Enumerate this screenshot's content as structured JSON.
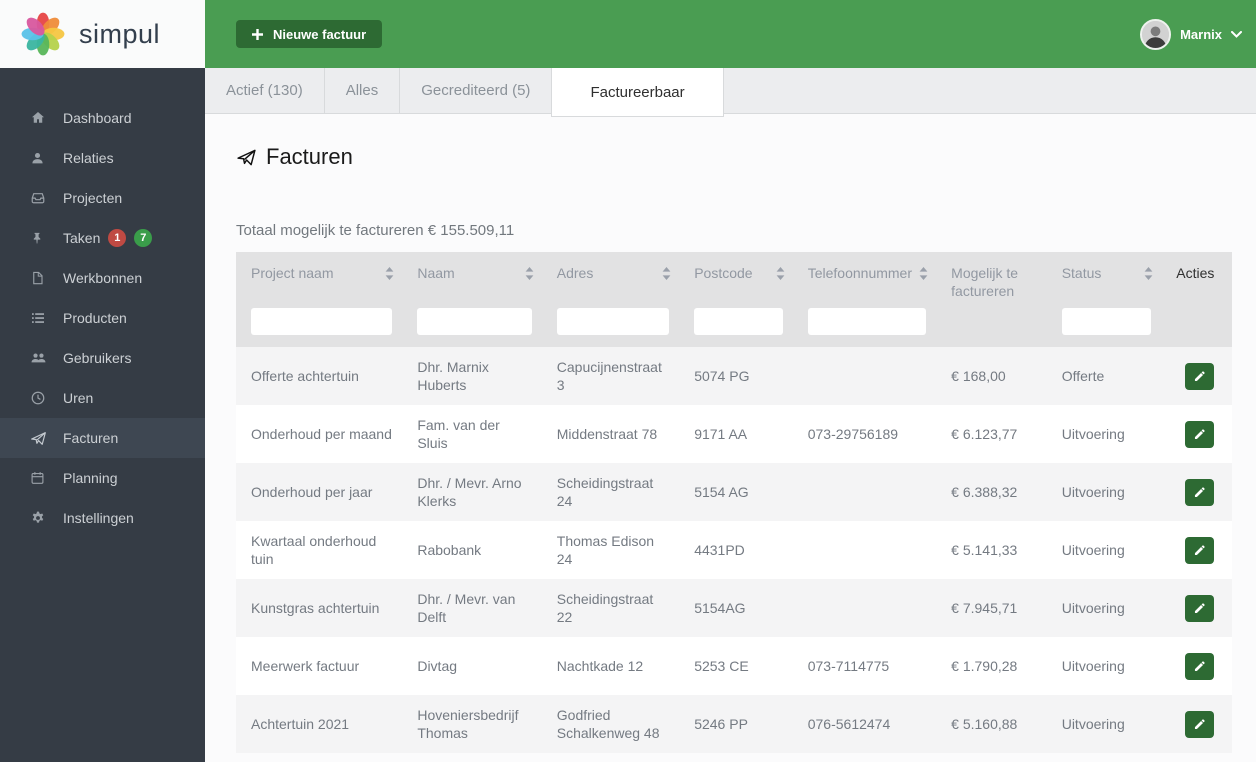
{
  "brand": {
    "name": "simpul"
  },
  "topbar": {
    "new_invoice_label": "Nieuwe factuur",
    "user_name": "Marnix"
  },
  "sidebar": {
    "items": [
      {
        "label": "Dashboard",
        "icon": "home"
      },
      {
        "label": "Relaties",
        "icon": "user"
      },
      {
        "label": "Projecten",
        "icon": "inbox"
      },
      {
        "label": "Taken",
        "icon": "pin",
        "badges": [
          {
            "value": "1",
            "color": "#bf4a43"
          },
          {
            "value": "7",
            "color": "#3a9d4a"
          }
        ]
      },
      {
        "label": "Werkbonnen",
        "icon": "document"
      },
      {
        "label": "Producten",
        "icon": "list"
      },
      {
        "label": "Gebruikers",
        "icon": "users"
      },
      {
        "label": "Uren",
        "icon": "clock"
      },
      {
        "label": "Facturen",
        "icon": "paper-plane",
        "active": true
      },
      {
        "label": "Planning",
        "icon": "calendar"
      },
      {
        "label": "Instellingen",
        "icon": "gear"
      }
    ]
  },
  "tabs": [
    {
      "label": "Actief (130)"
    },
    {
      "label": "Alles"
    },
    {
      "label": "Gecrediteerd (5)"
    },
    {
      "label": "Factureerbaar",
      "active": true
    }
  ],
  "page": {
    "title": "Facturen",
    "total_line": "Totaal mogelijk te factureren € 155.509,11"
  },
  "table": {
    "columns": [
      {
        "label": "Project naam",
        "sortable": true,
        "filter": true
      },
      {
        "label": "Naam",
        "sortable": true,
        "filter": true
      },
      {
        "label": "Adres",
        "sortable": true,
        "filter": true
      },
      {
        "label": "Postcode",
        "sortable": true,
        "filter": true
      },
      {
        "label": "Telefoonnummer",
        "sortable": true,
        "filter": true
      },
      {
        "label": "Mogelijk te factureren",
        "sortable": false,
        "filter": false
      },
      {
        "label": "Status",
        "sortable": true,
        "filter": true
      },
      {
        "label": "Acties",
        "sortable": false,
        "filter": false,
        "dark": true
      }
    ],
    "rows": [
      {
        "project_naam": "Offerte achtertuin",
        "naam": "Dhr. Marnix Huberts",
        "adres": "Capucijnenstraat 3",
        "postcode": "5074 PG",
        "telefoonnummer": "",
        "mogelijk_te_factureren": "€ 168,00",
        "status": "Offerte"
      },
      {
        "project_naam": "Onderhoud per maand",
        "naam": "Fam. van der Sluis",
        "adres": "Middenstraat 78",
        "postcode": "9171 AA",
        "telefoonnummer": "073-29756189",
        "mogelijk_te_factureren": "€ 6.123,77",
        "status": "Uitvoering"
      },
      {
        "project_naam": "Onderhoud per jaar",
        "naam": "Dhr. / Mevr. Arno Klerks",
        "adres": "Scheidingstraat 24",
        "postcode": "5154 AG",
        "telefoonnummer": "",
        "mogelijk_te_factureren": "€ 6.388,32",
        "status": "Uitvoering"
      },
      {
        "project_naam": "Kwartaal onderhoud tuin",
        "naam": "Rabobank",
        "adres": "Thomas Edison 24",
        "postcode": "4431PD",
        "telefoonnummer": "",
        "mogelijk_te_factureren": "€ 5.141,33",
        "status": "Uitvoering"
      },
      {
        "project_naam": "Kunstgras achtertuin",
        "naam": "Dhr. / Mevr. van Delft",
        "adres": "Scheidingstraat 22",
        "postcode": "5154AG",
        "telefoonnummer": "",
        "mogelijk_te_factureren": "€ 7.945,71",
        "status": "Uitvoering"
      },
      {
        "project_naam": "Meerwerk factuur",
        "naam": "Divtag",
        "adres": "Nachtkade 12",
        "postcode": "5253 CE",
        "telefoonnummer": "073-7114775",
        "mogelijk_te_factureren": "€ 1.790,28",
        "status": "Uitvoering"
      },
      {
        "project_naam": "Achtertuin 2021",
        "naam": "Hoveniersbedrijf Thomas",
        "adres": "Godfried Schalkenweg 48",
        "postcode": "5246 PP",
        "telefoonnummer": "076-5612474",
        "mogelijk_te_factureren": "€ 5.160,88",
        "status": "Uitvoering"
      }
    ]
  },
  "colors": {
    "header_green": "#4a9d52",
    "button_green": "#2d6a33",
    "sidebar_dark": "#353c45",
    "sidebar_active": "#3e4752",
    "badge_red": "#bf4a43",
    "badge_green": "#3a9d4a"
  }
}
